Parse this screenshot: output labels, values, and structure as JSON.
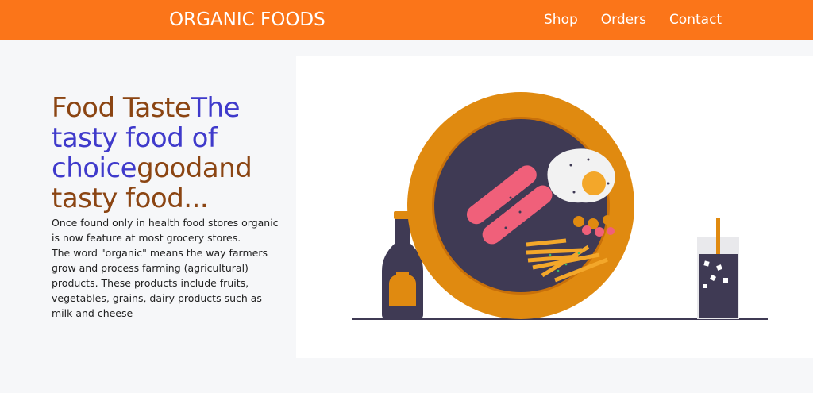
{
  "navbar": {
    "brand": "ORGANIC FOODS",
    "links": [
      "Shop",
      "Orders",
      "Contact"
    ]
  },
  "hero": {
    "headline_parts": [
      "Food Taste",
      "The tasty food of choice",
      "good",
      "and tasty food..."
    ],
    "paragraph_1": "Once found only in health food stores organic is now feature at most grocery stores.",
    "paragraph_2": "The word \"organic\" means the way farmers grow and process farming (agricultural) products. These products include fruits, vegetables, grains, dairy products such as milk and cheese"
  },
  "colors": {
    "accent": "#fb7519",
    "headline_brown": "#8b4513",
    "headline_blue": "#3f3acb",
    "plate": "#e08a10",
    "dark": "#3f3a54"
  },
  "illustration": {
    "icons": [
      "sauce-bottle-icon",
      "plate-icon",
      "drink-glass-icon"
    ]
  }
}
